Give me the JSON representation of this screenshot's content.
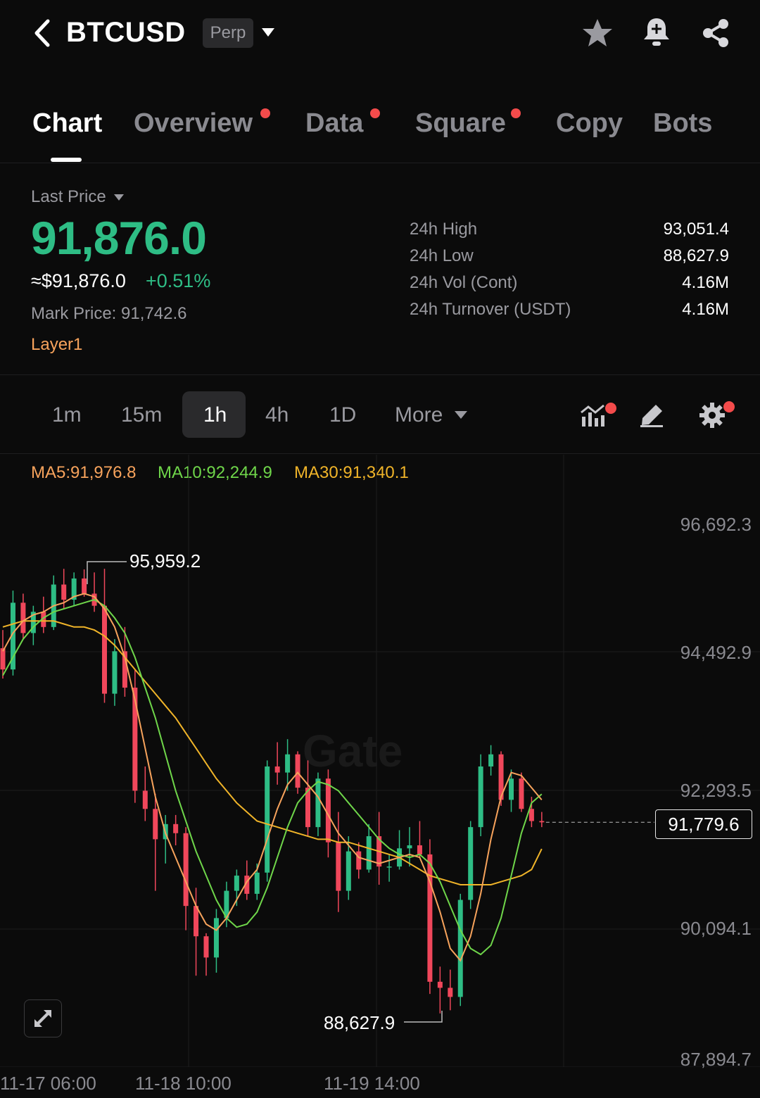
{
  "header": {
    "symbol": "BTCUSD",
    "type_badge": "Perp"
  },
  "tabs": [
    {
      "label": "Chart",
      "dot": false
    },
    {
      "label": "Overview",
      "dot": true
    },
    {
      "label": "Data",
      "dot": true
    },
    {
      "label": "Square",
      "dot": true
    },
    {
      "label": "Copy",
      "dot": false
    },
    {
      "label": "Bots",
      "dot": false
    }
  ],
  "price": {
    "label": "Last Price",
    "last": "91,876.0",
    "usd": "≈$91,876.0",
    "change": "+0.51%",
    "mark_label": "Mark Price:",
    "mark_value": "91,742.6",
    "tag": "Layer1"
  },
  "stats": [
    {
      "label": "24h High",
      "value": "93,051.4"
    },
    {
      "label": "24h Low",
      "value": "88,627.9"
    },
    {
      "label": "24h Vol (Cont)",
      "value": "4.16M"
    },
    {
      "label": "24h Turnover (USDT)",
      "value": "4.16M"
    }
  ],
  "timeframes": [
    "1m",
    "15m",
    "1h",
    "4h",
    "1D",
    "More"
  ],
  "active_timeframe": "1h",
  "ma": {
    "ma5": "MA5:91,976.8",
    "ma10": "MA10:92,244.9",
    "ma30": "MA30:91,340.1"
  },
  "chart": {
    "current_price": "91,779.6",
    "high_label": "95,959.2",
    "low_label": "88,627.9",
    "watermark": "Gate",
    "y_ticks": [
      "96,692.3",
      "94,492.9",
      "92,293.5",
      "90,094.1",
      "87,894.7"
    ],
    "x_ticks": [
      "11-17 06:00",
      "11-18 10:00",
      "11-19 14:00"
    ]
  },
  "colors": {
    "up": "#2ebd85",
    "down": "#f0475b",
    "ma5": "#f7a35c",
    "ma10": "#6fd64a",
    "ma30": "#f0b429",
    "accent_dot": "#f34b4b"
  },
  "chart_data": {
    "type": "candlestick",
    "interval": "1h",
    "candles": [
      {
        "o": 94650,
        "h": 94950,
        "l": 94150,
        "c": 94300
      },
      {
        "o": 94300,
        "h": 95600,
        "l": 94200,
        "c": 95400
      },
      {
        "o": 95400,
        "h": 95550,
        "l": 94800,
        "c": 94900
      },
      {
        "o": 94900,
        "h": 95350,
        "l": 94700,
        "c": 95250
      },
      {
        "o": 95250,
        "h": 95500,
        "l": 94900,
        "c": 95000
      },
      {
        "o": 95000,
        "h": 95850,
        "l": 94950,
        "c": 95700
      },
      {
        "o": 95700,
        "h": 95959,
        "l": 95300,
        "c": 95450
      },
      {
        "o": 95450,
        "h": 95900,
        "l": 95350,
        "c": 95800
      },
      {
        "o": 95800,
        "h": 95950,
        "l": 95500,
        "c": 95550
      },
      {
        "o": 95550,
        "h": 95900,
        "l": 95250,
        "c": 95350
      },
      {
        "o": 95350,
        "h": 95959,
        "l": 93750,
        "c": 93900
      },
      {
        "o": 93900,
        "h": 94800,
        "l": 93700,
        "c": 94600
      },
      {
        "o": 94600,
        "h": 95000,
        "l": 93850,
        "c": 94000
      },
      {
        "o": 94000,
        "h": 94300,
        "l": 92100,
        "c": 92300
      },
      {
        "o": 92300,
        "h": 92700,
        "l": 91800,
        "c": 92000
      },
      {
        "o": 92000,
        "h": 92250,
        "l": 90650,
        "c": 91500
      },
      {
        "o": 91500,
        "h": 91900,
        "l": 91100,
        "c": 91750
      },
      {
        "o": 91750,
        "h": 91900,
        "l": 91400,
        "c": 91600
      },
      {
        "o": 91600,
        "h": 91700,
        "l": 90000,
        "c": 90400
      },
      {
        "o": 90400,
        "h": 90700,
        "l": 89250,
        "c": 89900
      },
      {
        "o": 89900,
        "h": 89950,
        "l": 89250,
        "c": 89550
      },
      {
        "o": 89550,
        "h": 90350,
        "l": 89300,
        "c": 90200
      },
      {
        "o": 90200,
        "h": 90800,
        "l": 90050,
        "c": 90650
      },
      {
        "o": 90650,
        "h": 91000,
        "l": 90400,
        "c": 90900
      },
      {
        "o": 90900,
        "h": 91150,
        "l": 90500,
        "c": 90600
      },
      {
        "o": 90600,
        "h": 91100,
        "l": 90500,
        "c": 90950
      },
      {
        "o": 90950,
        "h": 92800,
        "l": 90800,
        "c": 92700
      },
      {
        "o": 92700,
        "h": 93100,
        "l": 92400,
        "c": 92600
      },
      {
        "o": 92600,
        "h": 93150,
        "l": 92300,
        "c": 92900
      },
      {
        "o": 92900,
        "h": 92950,
        "l": 92250,
        "c": 92350
      },
      {
        "o": 92350,
        "h": 92800,
        "l": 91550,
        "c": 91700
      },
      {
        "o": 91700,
        "h": 92600,
        "l": 91550,
        "c": 92500
      },
      {
        "o": 92500,
        "h": 92650,
        "l": 91200,
        "c": 91450
      },
      {
        "o": 91450,
        "h": 91950,
        "l": 90300,
        "c": 90650
      },
      {
        "o": 90650,
        "h": 91550,
        "l": 90500,
        "c": 91300
      },
      {
        "o": 91300,
        "h": 91450,
        "l": 90850,
        "c": 91000
      },
      {
        "o": 91000,
        "h": 91750,
        "l": 90950,
        "c": 91550
      },
      {
        "o": 91550,
        "h": 91950,
        "l": 90750,
        "c": 91050
      },
      {
        "o": 91050,
        "h": 91250,
        "l": 90800,
        "c": 91050
      },
      {
        "o": 91050,
        "h": 91650,
        "l": 91000,
        "c": 91350
      },
      {
        "o": 91350,
        "h": 91700,
        "l": 91050,
        "c": 91400
      },
      {
        "o": 91400,
        "h": 91800,
        "l": 91200,
        "c": 91250
      },
      {
        "o": 91250,
        "h": 91500,
        "l": 88950,
        "c": 89150
      },
      {
        "o": 89150,
        "h": 89400,
        "l": 88627.9,
        "c": 89050
      },
      {
        "o": 89050,
        "h": 89350,
        "l": 88680,
        "c": 88900
      },
      {
        "o": 88900,
        "h": 90600,
        "l": 88750,
        "c": 90500
      },
      {
        "o": 90500,
        "h": 91800,
        "l": 90350,
        "c": 91700
      },
      {
        "o": 91700,
        "h": 92900,
        "l": 91550,
        "c": 92700
      },
      {
        "o": 92700,
        "h": 93051.4,
        "l": 92550,
        "c": 92900
      },
      {
        "o": 92900,
        "h": 92950,
        "l": 92050,
        "c": 92150
      },
      {
        "o": 92150,
        "h": 92650,
        "l": 91950,
        "c": 92500
      },
      {
        "o": 92500,
        "h": 92600,
        "l": 91950,
        "c": 92000
      },
      {
        "o": 92000,
        "h": 92200,
        "l": 91700,
        "c": 91800
      },
      {
        "o": 91800,
        "h": 91950,
        "l": 91700,
        "c": 91779.6
      }
    ],
    "ma5_series": [
      94600,
      94900,
      95100,
      95200,
      95250,
      95350,
      95400,
      95500,
      95550,
      95500,
      95300,
      95000,
      94500,
      93800,
      93000,
      92200,
      91600,
      91200,
      90800,
      90400,
      90100,
      90000,
      90200,
      90500,
      90800,
      91000,
      91500,
      92000,
      92400,
      92600,
      92400,
      92200,
      91900,
      91600,
      91400,
      91200,
      91150,
      91100,
      91150,
      91200,
      91250,
      91200,
      90800,
      90300,
      89700,
      89500,
      89900,
      90600,
      91500,
      92200,
      92600,
      92550,
      92350,
      92150
    ],
    "ma10_series": [
      94200,
      94500,
      94800,
      95000,
      95150,
      95250,
      95300,
      95350,
      95400,
      95450,
      95350,
      95150,
      94900,
      94500,
      94000,
      93500,
      92900,
      92300,
      91800,
      91300,
      90900,
      90500,
      90200,
      90050,
      90100,
      90300,
      90700,
      91200,
      91700,
      92100,
      92300,
      92450,
      92400,
      92300,
      92100,
      91900,
      91700,
      91500,
      91350,
      91250,
      91200,
      91250,
      91100,
      90800,
      90400,
      90000,
      89700,
      89600,
      89750,
      90200,
      90900,
      91600,
      92100,
      92244.9
    ],
    "ma30_series": [
      95000,
      95050,
      95100,
      95100,
      95100,
      95100,
      95050,
      95000,
      95000,
      94950,
      94850,
      94700,
      94500,
      94300,
      94100,
      93900,
      93700,
      93500,
      93250,
      93000,
      92750,
      92500,
      92300,
      92100,
      91950,
      91800,
      91750,
      91700,
      91650,
      91600,
      91550,
      91500,
      91500,
      91450,
      91450,
      91400,
      91350,
      91300,
      91250,
      91200,
      91100,
      91000,
      90900,
      90850,
      90800,
      90750,
      90750,
      90750,
      90750,
      90800,
      90850,
      90900,
      91000,
      91340.1
    ]
  }
}
